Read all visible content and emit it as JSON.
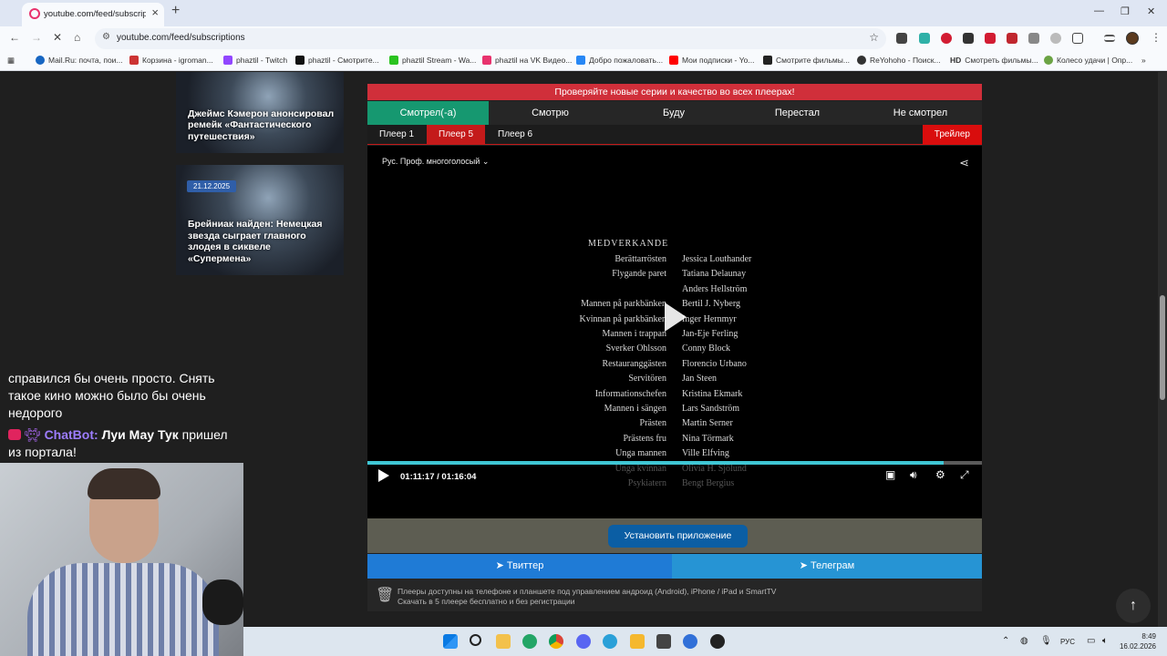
{
  "browser": {
    "tab_title": "youtube.com/feed/subscription",
    "url": "youtube.com/feed/subscriptions",
    "bookmarks": [
      "Mail.Ru: почта, пои...",
      "Корзина - igroman...",
      "phaztil - Twitch",
      "phaztil - Смотрите...",
      "phaztil Stream - Wa...",
      "phaztil на VK Видео...",
      "Добро пожаловать...",
      "Мои подписки - Yo...",
      "Смотрите фильмы...",
      "ReYohoho - Поиск...",
      "Смотреть фильмы...",
      "Колесо удачи | Опр..."
    ],
    "bookmark_hd_badge": "HD"
  },
  "news": [
    {
      "title": "Джеймс Кэмерон анонсировал ремейк «Фантастического путешествия»"
    },
    {
      "date": "21.12.2025",
      "title": "Брейниак найден: Немецкая звезда сыграет главного злодея в сиквеле «Супермена»"
    }
  ],
  "player": {
    "notice": "Проверяйте новые серии и качество во всех плеерах!",
    "statuses": [
      "Смотрел(-а)",
      "Смотрю",
      "Буду",
      "Перестал",
      "Не смотрел"
    ],
    "players": [
      "Плеер 1",
      "Плеер 5",
      "Плеер 6"
    ],
    "active_player": "Плеер 5",
    "trailer": "Трейлер",
    "voice": "Рус. Проф. многоголосый",
    "time": "01:11:17 / 01:16:04",
    "progress_fraction": 0.937,
    "credits_heading": "MEDVERKANDE",
    "credits": [
      {
        "role": "Berättarrösten",
        "name": "Jessica Louthander"
      },
      {
        "role": "Flygande paret",
        "name": "Tatiana Delaunay"
      },
      {
        "role": "",
        "name": "Anders Hellström"
      },
      {
        "role": "Mannen på parkbänken",
        "name": "Bertil J. Nyberg"
      },
      {
        "role": "Kvinnan på parkbänken",
        "name": "Inger Hernmyr"
      },
      {
        "role": "Mannen i trappan",
        "name": "Jan-Eje Ferling"
      },
      {
        "role": "Sverker Ohlsson",
        "name": "Conny Block"
      },
      {
        "role": "Restauranggästen",
        "name": "Florencio Urbano"
      },
      {
        "role": "Servitören",
        "name": "Jan Steen"
      },
      {
        "role": "Informationschefen",
        "name": "Kristina Ekmark"
      },
      {
        "role": "Mannen i sängen",
        "name": "Lars Sandström"
      },
      {
        "role": "Prästen",
        "name": "Martin Serner"
      },
      {
        "role": "Prästens fru",
        "name": "Nina Törmark"
      },
      {
        "role": "Unga mannen",
        "name": "Ville Elfving"
      },
      {
        "role": "Unga kvinnan",
        "name": "Olivia H. Sjölund"
      },
      {
        "role": "Psykiatern",
        "name": "Bengt Bergius"
      }
    ],
    "install_label": "Установить приложение",
    "twitter_label": "Твиттер",
    "telegram_label": "Телеграм",
    "apps_line1": "Плееры доступны на телефоне и планшете под управлением андроид (Android), iPhone / iPad и SmartTV",
    "apps_line2": "Скачать в 5 плеере бесплатно и без регистрации"
  },
  "stream_overlay": {
    "chat_lines": [
      "справился бы очень просто. Снять",
      "такое кино можно было бы очень",
      "недорого"
    ],
    "bot_name": "ChatBot:",
    "bot_message_bold": "Луи Мау Тук",
    "bot_message_rest": " пришел",
    "bot_message_line2": "из портала!"
  },
  "taskbar": {
    "lang": "РУС",
    "time": "8:49",
    "date": "16.02.2026"
  },
  "colors": {
    "accent_red": "#d02f3a",
    "status_active": "#169870",
    "player_active": "#c41a1a",
    "progress": "#3fc6d4"
  }
}
